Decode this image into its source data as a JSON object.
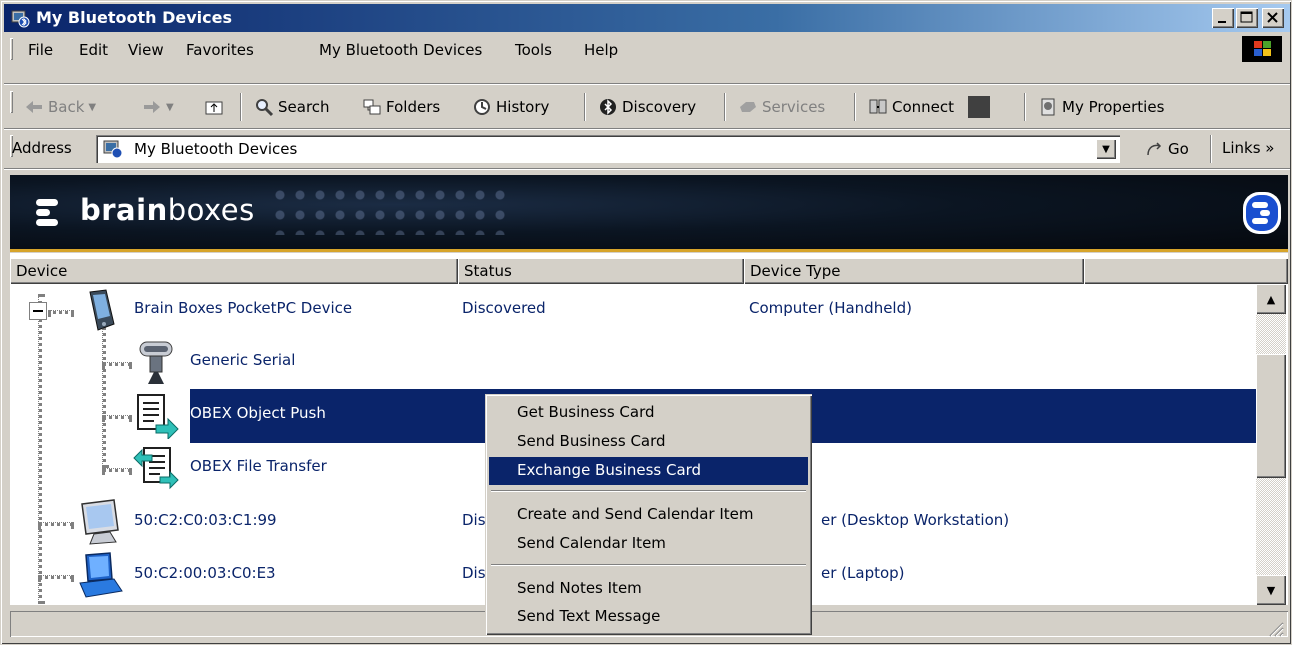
{
  "window": {
    "title": "My Bluetooth Devices"
  },
  "menubar": {
    "items": [
      "File",
      "Edit",
      "View",
      "Favorites",
      "My Bluetooth Devices",
      "Tools",
      "Help"
    ]
  },
  "toolbar": {
    "back": "Back",
    "search": "Search",
    "folders": "Folders",
    "history": "History",
    "discovery": "Discovery",
    "services": "Services",
    "connect": "Connect",
    "my_properties": "My Properties"
  },
  "address": {
    "label": "Address",
    "value": "My Bluetooth Devices",
    "go": "Go",
    "links": "Links »"
  },
  "banner": {
    "brand_bold": "brain",
    "brand_rest": "boxes"
  },
  "columns": [
    "Device",
    "Status",
    "Device Type"
  ],
  "rows": [
    {
      "name": "Brain Boxes PocketPC Device",
      "status": "Discovered",
      "type": "Computer (Handheld)",
      "icon": "pocketpc-icon"
    },
    {
      "name": "Generic Serial",
      "status": "",
      "type": "",
      "icon": "serial-plug-icon"
    },
    {
      "name": "OBEX Object Push",
      "status": "",
      "type": "",
      "icon": "obex-push-icon"
    },
    {
      "name": "OBEX File Transfer",
      "status": "",
      "type": "",
      "icon": "obex-transfer-icon"
    },
    {
      "name": "50:C2:C0:03:C1:99",
      "status": "Dis",
      "type": "er (Desktop Workstation)",
      "icon": "desktop-monitor-icon"
    },
    {
      "name": "50:C2:00:03:C0:E3",
      "status": "Dis",
      "type": "er (Laptop)",
      "icon": "laptop-icon"
    }
  ],
  "context_menu": {
    "items": [
      "Get Business Card",
      "Send Business Card",
      "Exchange Business Card",
      "Create and Send Calendar Item",
      "Send Calendar Item",
      "Send Notes Item",
      "Send Text Message"
    ],
    "highlighted": "Exchange Business Card"
  },
  "colors": {
    "selection": "#0a246a",
    "link_text": "#0a246a",
    "accent_line": "#d7a42a",
    "face": "#d4d0c8"
  }
}
